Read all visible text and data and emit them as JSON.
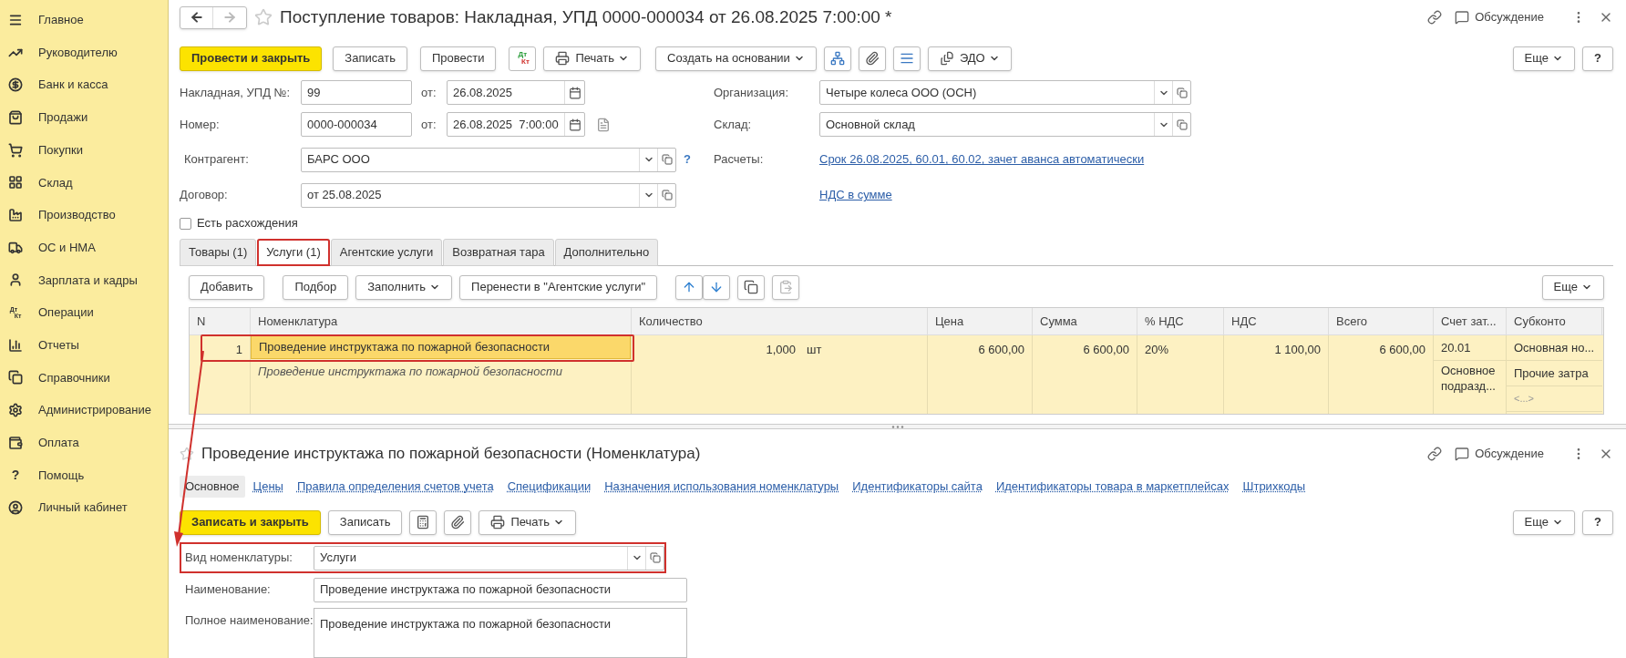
{
  "sidebar": {
    "items": [
      {
        "label": "Главное"
      },
      {
        "label": "Руководителю"
      },
      {
        "label": "Банк и касса"
      },
      {
        "label": "Продажи"
      },
      {
        "label": "Покупки"
      },
      {
        "label": "Склад"
      },
      {
        "label": "Производство"
      },
      {
        "label": "ОС и НМА"
      },
      {
        "label": "Зарплата и кадры"
      },
      {
        "label": "Операции",
        "icon_top": "Дт",
        "icon_bottom": "Кт"
      },
      {
        "label": "Отчеты"
      },
      {
        "label": "Справочники"
      },
      {
        "label": "Администрирование"
      },
      {
        "label": "Оплата"
      },
      {
        "label": "Помощь",
        "icon_char": "?"
      },
      {
        "label": "Личный кабинет"
      }
    ]
  },
  "document": {
    "title": "Поступление товаров: Накладная, УПД 0000-000034 от 26.08.2025 7:00:00 *",
    "discussion": "Обсуждение",
    "toolbar": {
      "post_close": "Провести и закрыть",
      "save": "Записать",
      "post": "Провести",
      "dt": "Дт",
      "kt": "Кт",
      "print": "Печать",
      "create_based": "Создать на основании",
      "edo": "ЭДО",
      "more": "Еще",
      "help": "?"
    },
    "invoice": {
      "label": "Накладная, УПД №:",
      "value": "99",
      "date_label": "от:",
      "date": "26.08.2025"
    },
    "number": {
      "label": "Номер:",
      "value": "0000-000034",
      "date_label": "от:",
      "date": "26.08.2025  7:00:00"
    },
    "counterparty": {
      "label": "Контрагент:",
      "value": "БАРС ООО",
      "help": "?"
    },
    "contract": {
      "label": "Договор:",
      "value": "от 25.08.2025"
    },
    "organization": {
      "label": "Организация:",
      "value": "Четыре колеса ООО (ОСН)"
    },
    "warehouse": {
      "label": "Склад:",
      "value": "Основной склад"
    },
    "settlements": {
      "label": "Расчеты:",
      "link": "Срок 26.08.2025, 60.01, 60.02, зачет аванса автоматически"
    },
    "vat_link": "НДС в сумме",
    "discrepancy": {
      "label": "Есть расхождения",
      "checked": false
    },
    "tabs": [
      {
        "label": "Товары (1)",
        "selected": false,
        "highlighted": false
      },
      {
        "label": "Услуги (1)",
        "selected": true,
        "highlighted": true
      },
      {
        "label": "Агентские услуги",
        "selected": false,
        "highlighted": false
      },
      {
        "label": "Возвратная тара",
        "selected": false,
        "highlighted": false
      },
      {
        "label": "Дополнительно",
        "selected": false,
        "highlighted": false
      }
    ],
    "table_toolbar": {
      "add": "Добавить",
      "pick": "Подбор",
      "fill": "Заполнить",
      "move": "Перенести в \"Агентские услуги\"",
      "more": "Еще"
    },
    "table": {
      "columns": [
        "N",
        "Номенклатура",
        "Количество",
        "Цена",
        "Сумма",
        "% НДС",
        "НДС",
        "Всего",
        "Счет зат...",
        "Субконто"
      ],
      "rows": [
        {
          "n": "1",
          "name": "Проведение инструктажа по пожарной безопасности",
          "full_name": "Проведение инструктажа по пожарной безопасности",
          "quantity": "1,000",
          "unit": "шт",
          "price": "6 600,00",
          "sum": "6 600,00",
          "vat_rate": "20%",
          "vat": "1 100,00",
          "total": "6 600,00",
          "account": "20.01",
          "account_sub": "Основное подразд...",
          "subconto": [
            "Основная но...",
            "Прочие затра",
            "<...>"
          ],
          "selected": true,
          "highlighted": true
        }
      ]
    }
  },
  "item_form": {
    "title": "Проведение инструктажа по пожарной безопасности (Номенклатура)",
    "discussion": "Обсуждение",
    "tabs": [
      {
        "label": "Основное",
        "selected": true
      },
      {
        "label": "Цены",
        "selected": false
      },
      {
        "label": "Правила определения счетов учета",
        "selected": false
      },
      {
        "label": "Спецификации",
        "selected": false
      },
      {
        "label": "Назначения использования номенклатуры",
        "selected": false
      },
      {
        "label": "Идентификаторы сайта",
        "selected": false
      },
      {
        "label": "Идентификаторы товара в маркетплейсах",
        "selected": false
      },
      {
        "label": "Штрихкоды",
        "selected": false
      }
    ],
    "toolbar": {
      "save_close": "Записать и закрыть",
      "save": "Записать",
      "print": "Печать",
      "more": "Еще",
      "help": "?"
    },
    "item_type": {
      "label": "Вид номенклатуры:",
      "value": "Услуги",
      "highlighted": true
    },
    "name": {
      "label": "Наименование:",
      "value": "Проведение инструктажа по пожарной безопасности"
    },
    "full_name": {
      "label": "Полное наименование:",
      "value": "Проведение инструктажа по пожарной безопасности"
    }
  }
}
